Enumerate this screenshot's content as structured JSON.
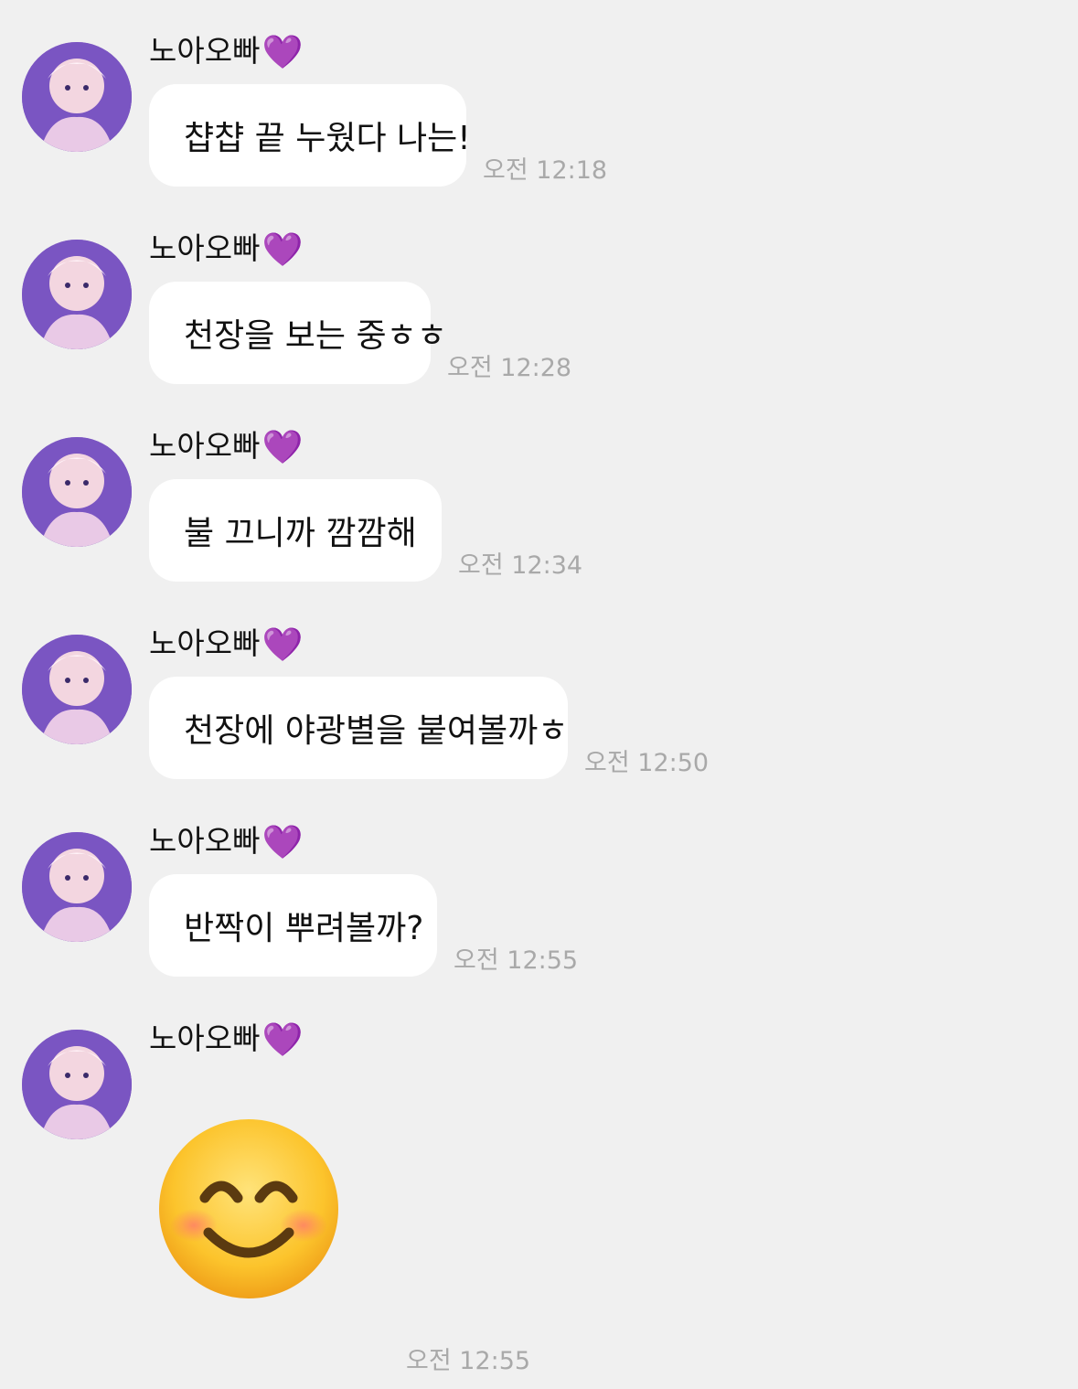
{
  "sender": {
    "name": "노아오빠",
    "heart": "💜",
    "heart_color": "#9b3ee8"
  },
  "messages": [
    {
      "text": "챱챱 끝 누웠다 나는!",
      "time": "오전 12:18"
    },
    {
      "text": "천장을 보는 중ㅎㅎ",
      "time": "오전 12:28"
    },
    {
      "text": "불 끄니까 깜깜해",
      "time": "오전 12:34"
    },
    {
      "text": "천장에 야광별을 붙여볼까ㅎ",
      "time": "오전 12:50"
    },
    {
      "text": "반짝이 뿌려볼까?",
      "time": "오전 12:55"
    },
    {
      "emoji": "smiling-face-with-smiling-eyes",
      "time": "오전 12:55"
    }
  ],
  "colors": {
    "background": "#f0f0f0",
    "bubble": "#ffffff",
    "timestamp": "#a9a9a9"
  }
}
